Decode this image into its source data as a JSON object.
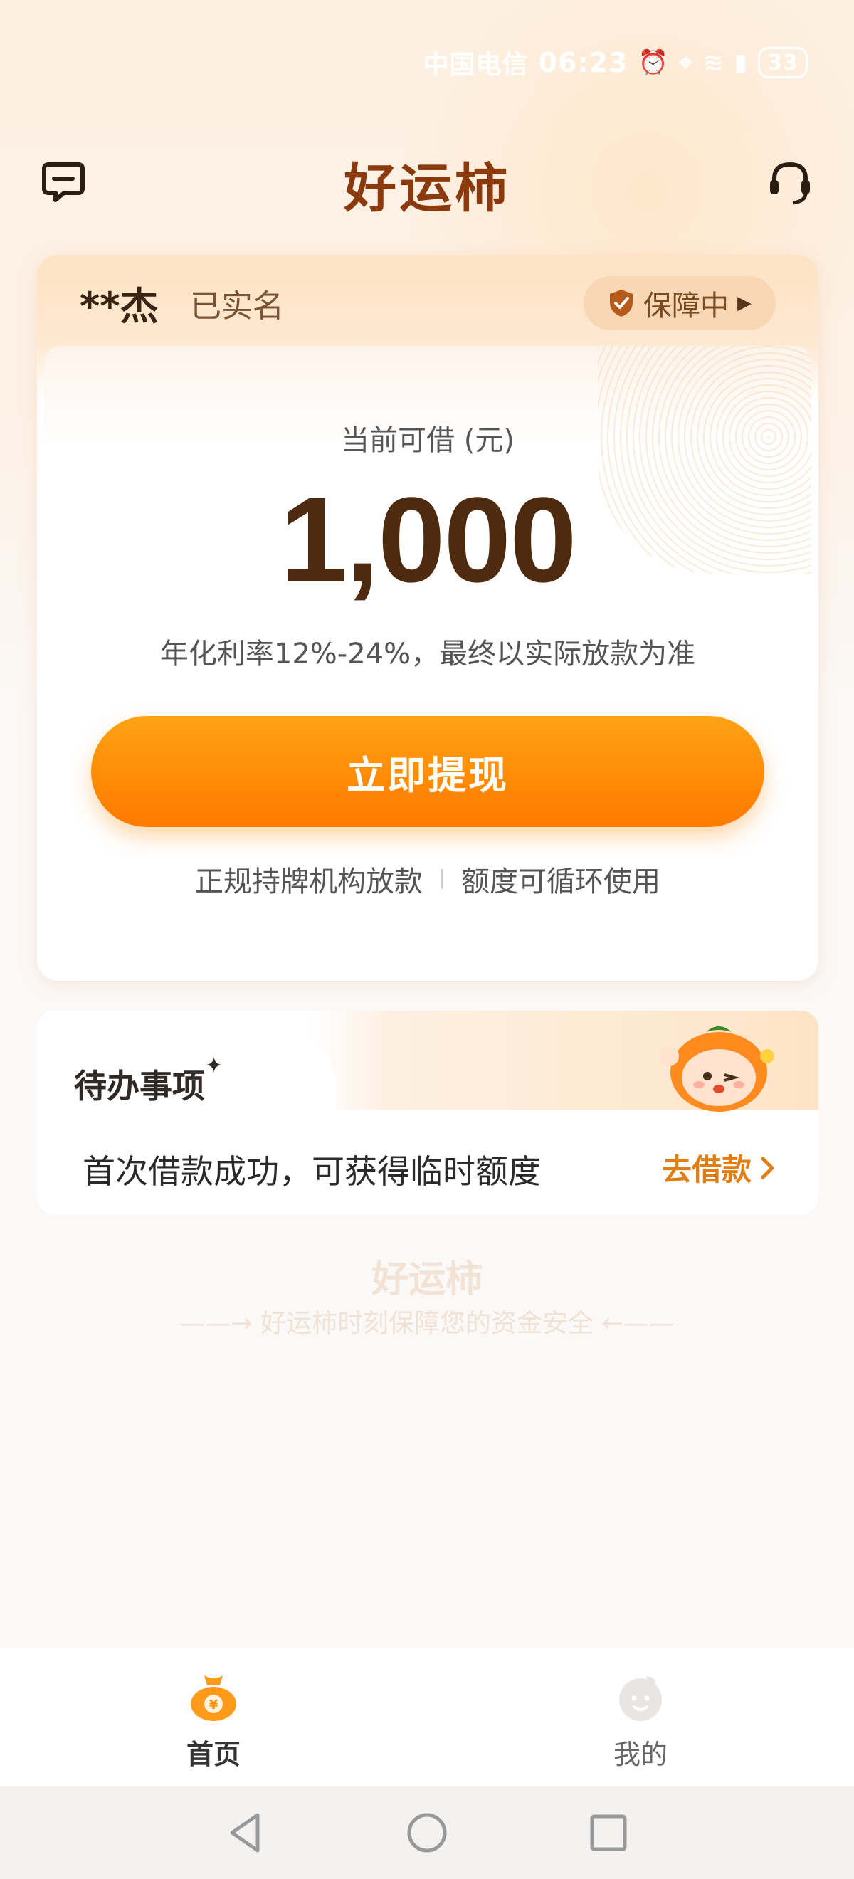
{
  "status_bar": {
    "carrier": "中国电信",
    "time": "06:23",
    "battery": "33"
  },
  "header": {
    "title": "好运柿"
  },
  "account": {
    "name": "**杰",
    "verify_status": "已实名",
    "guard_label": "保障中"
  },
  "credit": {
    "label": "当前可借 (元)",
    "amount": "1,000",
    "rate_note": "年化利率12%-24%，最终以实际放款为准",
    "cta_label": "立即提现",
    "features": [
      "正规持牌机构放款",
      "额度可循环使用"
    ]
  },
  "todo": {
    "title": "待办事项",
    "item_text": "首次借款成功，可获得临时额度",
    "item_link": "去借款"
  },
  "watermark": {
    "title": "好运柿",
    "subtitle": "好运柿时刻保障您的资金安全"
  },
  "bottom_nav": {
    "items": [
      {
        "label": "首页",
        "icon": "money-bag-icon",
        "active": true
      },
      {
        "label": "我的",
        "icon": "profile-face-icon",
        "active": false
      }
    ]
  },
  "colors": {
    "accent": "#ff8a05",
    "brand": "#8a3a0c",
    "link": "#e07d14"
  }
}
